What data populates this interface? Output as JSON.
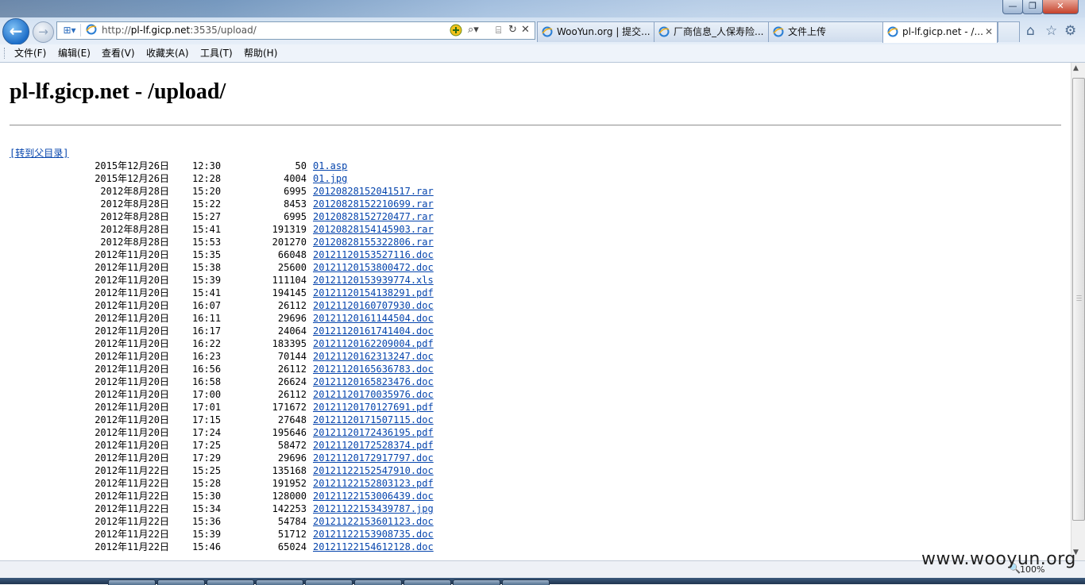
{
  "window": {
    "minimize_glyph": "—",
    "maximize_glyph": "❐",
    "close_glyph": "✕"
  },
  "toolbar": {
    "back_glyph": "←",
    "forward_glyph": "→",
    "address_prefix": "http://",
    "address_host": "pl-lf.gicp.net",
    "address_path": ":3535/upload/",
    "icons": [
      "compat-view-icon",
      "ie-page-icon",
      "add-favorite-icon",
      "search-icon",
      "compat-icon",
      "refresh-icon",
      "stop-icon",
      "home-icon",
      "favorites-star-icon",
      "tools-gear-icon"
    ]
  },
  "tabs": [
    {
      "label": "WooYun.org | 提交...",
      "active": false
    },
    {
      "label": "厂商信息_人保寿险...",
      "active": false
    },
    {
      "label": "文件上传",
      "active": false
    },
    {
      "label": "pl-lf.gicp.net - /...",
      "active": true,
      "close": "✕"
    }
  ],
  "menu": [
    {
      "label": "文件(F)"
    },
    {
      "label": "编辑(E)"
    },
    {
      "label": "查看(V)"
    },
    {
      "label": "收藏夹(A)"
    },
    {
      "label": "工具(T)"
    },
    {
      "label": "帮助(H)"
    }
  ],
  "page": {
    "heading": "pl-lf.gicp.net - /upload/",
    "parent_link": "[转到父目录]",
    "files": [
      {
        "date": "2015年12月26日",
        "time": "12:30",
        "size": "50",
        "name": "01.asp"
      },
      {
        "date": "2015年12月26日",
        "time": "12:28",
        "size": "4004",
        "name": "01.jpg"
      },
      {
        "date": "2012年8月28日",
        "time": "15:20",
        "size": "6995",
        "name": "20120828152041517.rar"
      },
      {
        "date": "2012年8月28日",
        "time": "15:22",
        "size": "8453",
        "name": "20120828152210699.rar"
      },
      {
        "date": "2012年8月28日",
        "time": "15:27",
        "size": "6995",
        "name": "20120828152720477.rar"
      },
      {
        "date": "2012年8月28日",
        "time": "15:41",
        "size": "191319",
        "name": "20120828154145903.rar"
      },
      {
        "date": "2012年8月28日",
        "time": "15:53",
        "size": "201270",
        "name": "20120828155322806.rar"
      },
      {
        "date": "2012年11月20日",
        "time": "15:35",
        "size": "66048",
        "name": "20121120153527116.doc"
      },
      {
        "date": "2012年11月20日",
        "time": "15:38",
        "size": "25600",
        "name": "20121120153800472.doc"
      },
      {
        "date": "2012年11月20日",
        "time": "15:39",
        "size": "111104",
        "name": "20121120153939774.xls"
      },
      {
        "date": "2012年11月20日",
        "time": "15:41",
        "size": "194145",
        "name": "20121120154138291.pdf"
      },
      {
        "date": "2012年11月20日",
        "time": "16:07",
        "size": "26112",
        "name": "20121120160707930.doc"
      },
      {
        "date": "2012年11月20日",
        "time": "16:11",
        "size": "29696",
        "name": "20121120161144504.doc"
      },
      {
        "date": "2012年11月20日",
        "time": "16:17",
        "size": "24064",
        "name": "20121120161741404.doc"
      },
      {
        "date": "2012年11月20日",
        "time": "16:22",
        "size": "183395",
        "name": "20121120162209004.pdf"
      },
      {
        "date": "2012年11月20日",
        "time": "16:23",
        "size": "70144",
        "name": "20121120162313247.doc"
      },
      {
        "date": "2012年11月20日",
        "time": "16:56",
        "size": "26112",
        "name": "20121120165636783.doc"
      },
      {
        "date": "2012年11月20日",
        "time": "16:58",
        "size": "26624",
        "name": "20121120165823476.doc"
      },
      {
        "date": "2012年11月20日",
        "time": "17:00",
        "size": "26112",
        "name": "20121120170035976.doc"
      },
      {
        "date": "2012年11月20日",
        "time": "17:01",
        "size": "171672",
        "name": "20121120170127691.pdf"
      },
      {
        "date": "2012年11月20日",
        "time": "17:15",
        "size": "27648",
        "name": "20121120171507115.doc"
      },
      {
        "date": "2012年11月20日",
        "time": "17:24",
        "size": "195646",
        "name": "20121120172436195.pdf"
      },
      {
        "date": "2012年11月20日",
        "time": "17:25",
        "size": "58472",
        "name": "20121120172528374.pdf"
      },
      {
        "date": "2012年11月20日",
        "time": "17:29",
        "size": "29696",
        "name": "20121120172917797.doc"
      },
      {
        "date": "2012年11月22日",
        "time": "15:25",
        "size": "135168",
        "name": "20121122152547910.doc"
      },
      {
        "date": "2012年11月22日",
        "time": "15:28",
        "size": "191952",
        "name": "20121122152803123.pdf"
      },
      {
        "date": "2012年11月22日",
        "time": "15:30",
        "size": "128000",
        "name": "20121122153006439.doc"
      },
      {
        "date": "2012年11月22日",
        "time": "15:34",
        "size": "142253",
        "name": "20121122153439787.jpg"
      },
      {
        "date": "2012年11月22日",
        "time": "15:36",
        "size": "54784",
        "name": "20121122153601123.doc"
      },
      {
        "date": "2012年11月22日",
        "time": "15:39",
        "size": "51712",
        "name": "20121122153908735.doc"
      },
      {
        "date": "2012年11月22日",
        "time": "15:46",
        "size": "65024",
        "name": "20121122154612128.doc"
      }
    ]
  },
  "statusbar": {
    "zoom": "100%"
  },
  "watermark": "www.wooyun.org",
  "colors": {
    "link": "#0645ad",
    "chrome": "#d5e3f3"
  }
}
